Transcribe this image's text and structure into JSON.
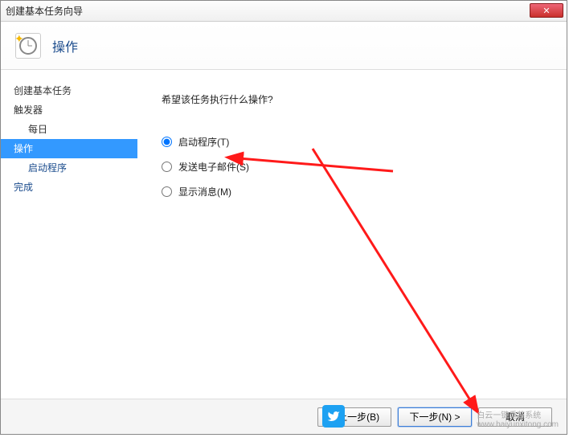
{
  "window": {
    "title": "创建基本任务向导",
    "close_x": "✕"
  },
  "header": {
    "title": "操作"
  },
  "sidebar": {
    "items": [
      {
        "label": "创建基本任务",
        "kind": "top"
      },
      {
        "label": "触发器",
        "kind": "top"
      },
      {
        "label": "每日",
        "kind": "sub"
      },
      {
        "label": "操作",
        "kind": "top-active"
      },
      {
        "label": "启动程序",
        "kind": "sub"
      },
      {
        "label": "完成",
        "kind": "top"
      }
    ]
  },
  "content": {
    "prompt": "希望该任务执行什么操作?",
    "options": [
      {
        "label": "启动程序(T)",
        "checked": true
      },
      {
        "label": "发送电子邮件(S)",
        "checked": false
      },
      {
        "label": "显示消息(M)",
        "checked": false
      }
    ]
  },
  "footer": {
    "back": "< 上一步(B)",
    "next": "下一步(N) >",
    "cancel": "取消"
  },
  "watermark": {
    "line1": "白云一键重装系统",
    "line2": "www.baiyunxitong.com"
  }
}
